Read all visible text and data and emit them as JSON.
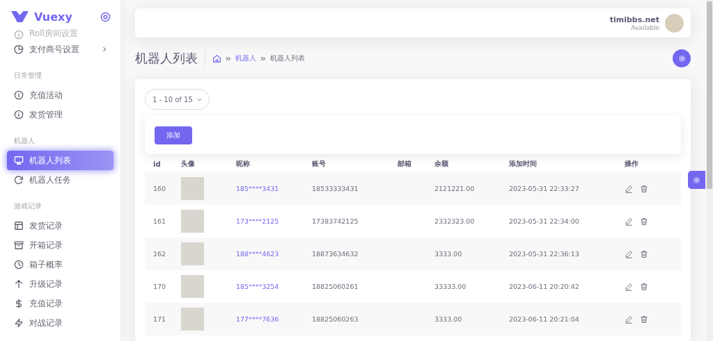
{
  "brand": {
    "name": "Vuexy"
  },
  "sidebar": {
    "items": [
      {
        "kind": "item",
        "label": "Roll房间设置",
        "faded": true,
        "selected": false,
        "has_submenu": false
      },
      {
        "kind": "item",
        "label": "支付商号设置",
        "faded": false,
        "selected": false,
        "has_submenu": true
      },
      {
        "kind": "header",
        "label": "日常管理"
      },
      {
        "kind": "item",
        "label": "充值活动",
        "faded": false,
        "selected": false,
        "has_submenu": false
      },
      {
        "kind": "item",
        "label": "发货管理",
        "faded": false,
        "selected": false,
        "has_submenu": false
      },
      {
        "kind": "header",
        "label": "机器人"
      },
      {
        "kind": "item",
        "label": "机器人列表",
        "faded": false,
        "selected": true,
        "has_submenu": false
      },
      {
        "kind": "item",
        "label": "机器人任务",
        "faded": false,
        "selected": false,
        "has_submenu": false
      },
      {
        "kind": "header",
        "label": "游戏记录"
      },
      {
        "kind": "item",
        "label": "发货记录",
        "faded": false,
        "selected": false,
        "has_submenu": false
      },
      {
        "kind": "item",
        "label": "开箱记录",
        "faded": false,
        "selected": false,
        "has_submenu": false
      },
      {
        "kind": "item",
        "label": "箱子概率",
        "faded": false,
        "selected": false,
        "has_submenu": false
      },
      {
        "kind": "item",
        "label": "升级记录",
        "faded": false,
        "selected": false,
        "has_submenu": false
      },
      {
        "kind": "item",
        "label": "充值记录",
        "faded": false,
        "selected": false,
        "has_submenu": false
      },
      {
        "kind": "item",
        "label": "对战记录",
        "faded": false,
        "selected": false,
        "has_submenu": false
      }
    ]
  },
  "user": {
    "name": "timibbs.net",
    "status": "Available"
  },
  "page": {
    "title": "机器人列表",
    "breadcrumb": [
      "机器人",
      "机器人列表"
    ]
  },
  "pagination": {
    "label": "1 - 10 of 15"
  },
  "add_button": "添加",
  "table": {
    "columns": [
      "id",
      "头像",
      "昵称",
      "账号",
      "邮箱",
      "余额",
      "添加时间",
      "操作"
    ],
    "rows": [
      {
        "id": "160",
        "nickname": "185****3431",
        "account": "18533333431",
        "balance": "2121221.00",
        "added": "2023-05-31 22:33:27"
      },
      {
        "id": "161",
        "nickname": "173****2125",
        "account": "17383742125",
        "balance": "2332323.00",
        "added": "2023-05-31 22:34:00"
      },
      {
        "id": "162",
        "nickname": "188****4623",
        "account": "18873634632",
        "balance": "3333.00",
        "added": "2023-05-31 22:36:13"
      },
      {
        "id": "170",
        "nickname": "185****3254",
        "account": "18825060261",
        "balance": "33333.00",
        "added": "2023-06-11 20:20:42"
      },
      {
        "id": "171",
        "nickname": "177****7636",
        "account": "18825060263",
        "balance": "3333.00",
        "added": "2023-06-11 20:21:04"
      }
    ]
  }
}
